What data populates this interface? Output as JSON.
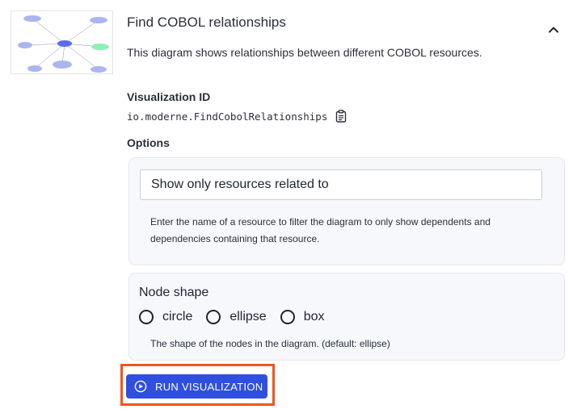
{
  "recipe": {
    "title": "Find COBOL relationships",
    "description": "This diagram shows relationships between different COBOL resources."
  },
  "visualization": {
    "heading": "Visualization ID",
    "id": "io.moderne.FindCobolRelationships"
  },
  "options": {
    "heading": "Options",
    "filter": {
      "placeholder": "Show only resources related to",
      "value": "",
      "help": "Enter the name of a resource to filter the diagram to only show dependents and dependencies containing that resource."
    },
    "node_shape": {
      "label": "Node shape",
      "choices": [
        "circle",
        "ellipse",
        "box"
      ],
      "help": "The shape of the nodes in the diagram. (default: ellipse)"
    }
  },
  "actions": {
    "run_label": "RUN VISUALIZATION"
  },
  "colors": {
    "accent": "#2f4fe0",
    "highlight": "#f0551e",
    "node": "#aab6f0",
    "node_center": "#5a6cf0",
    "node_green": "#8ef0b4"
  }
}
